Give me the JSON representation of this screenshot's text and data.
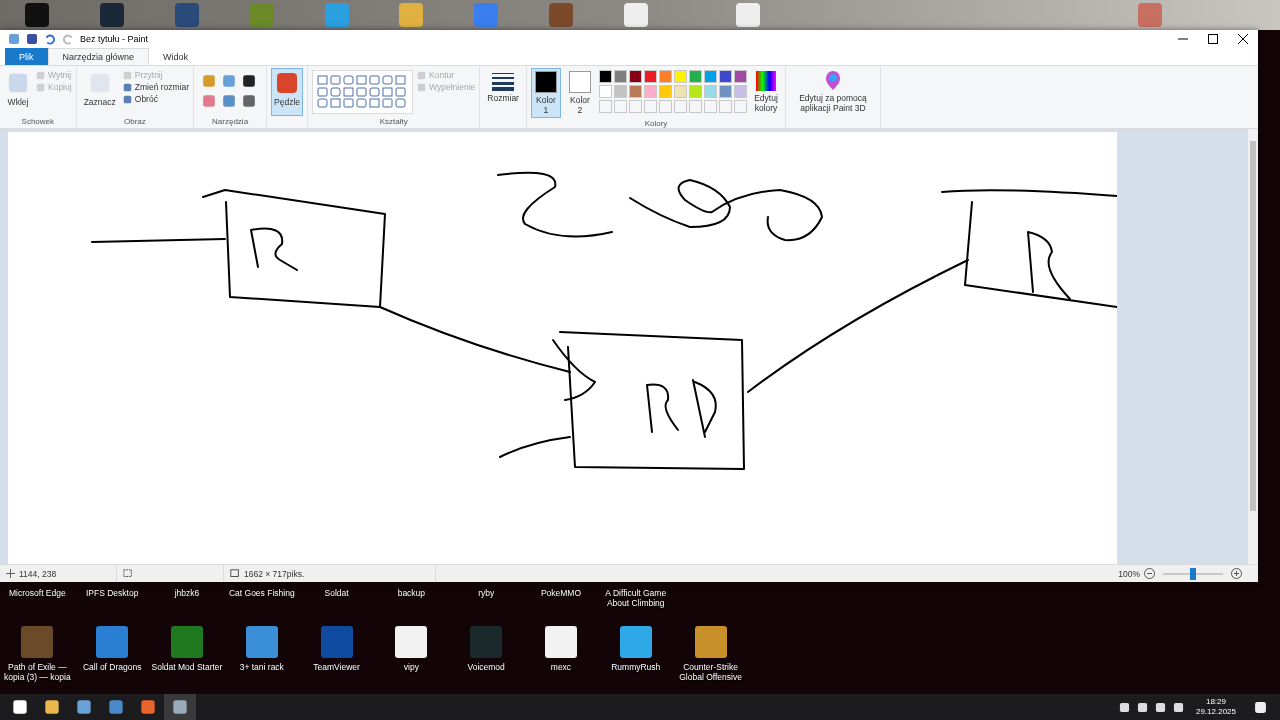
{
  "window": {
    "title": "Bez tytułu - Paint"
  },
  "tabs": [
    {
      "label": "Plik",
      "kind": "file",
      "selected": false
    },
    {
      "label": "Narzędzia główne",
      "kind": "tab",
      "selected": true
    },
    {
      "label": "Widok",
      "kind": "tab",
      "selected": false
    }
  ],
  "ribbon": {
    "groups": [
      {
        "kind": "buttons",
        "label": "Schowek",
        "large": {
          "label": "Wklej"
        },
        "small": [
          {
            "label": "Wytnij",
            "disabled": true
          },
          {
            "label": "Kopiuj",
            "disabled": true
          }
        ]
      },
      {
        "kind": "buttons",
        "label": "Obraz",
        "large": {
          "label": "Zaznacz"
        },
        "small": [
          {
            "label": "Przytnij",
            "disabled": true
          },
          {
            "label": "Zmień rozmiar",
            "disabled": false
          },
          {
            "label": "Obróć",
            "disabled": false
          }
        ]
      },
      {
        "kind": "tools",
        "label": "Narzędzia"
      },
      {
        "kind": "brushes",
        "large": {
          "label": "Pędzle",
          "selected": true
        }
      },
      {
        "kind": "shapes",
        "label": "Kształty",
        "small": [
          {
            "label": "Kontur",
            "disabled": true
          },
          {
            "label": "Wypełnienie",
            "disabled": true
          }
        ]
      },
      {
        "kind": "size",
        "large": {
          "label": "Rozmiar"
        }
      },
      {
        "kind": "colors",
        "label": "Kolory",
        "slots": [
          {
            "label": "Kolor 1",
            "color": "#000000",
            "selected": true
          },
          {
            "label": "Kolor 2",
            "color": "#ffffff",
            "selected": false
          }
        ],
        "palette": [
          {
            "color": "#000000"
          },
          {
            "color": "#7f7f7f"
          },
          {
            "color": "#880015"
          },
          {
            "color": "#ed1c24"
          },
          {
            "color": "#ff7f27"
          },
          {
            "color": "#fff200"
          },
          {
            "color": "#22b14c"
          },
          {
            "color": "#00a2e8"
          },
          {
            "color": "#3f48cc"
          },
          {
            "color": "#a349a4"
          },
          {
            "color": "#ffffff"
          },
          {
            "color": "#c3c3c3"
          },
          {
            "color": "#b97a57"
          },
          {
            "color": "#ffaec9"
          },
          {
            "color": "#ffc90e"
          },
          {
            "color": "#efe4b0"
          },
          {
            "color": "#b5e61d"
          },
          {
            "color": "#99d9ea"
          },
          {
            "color": "#7092be"
          },
          {
            "color": "#c8bfe7"
          }
        ],
        "edit": {
          "label": "Edytuj kolory"
        }
      },
      {
        "kind": "paint3d",
        "large": {
          "label": "Edytuj za pomocą aplikacji Paint 3D"
        }
      }
    ]
  },
  "status_bar": {
    "position": "1144, 238",
    "size": "1662 × 717piks.",
    "zoom": "100%",
    "zoom_slider": {
      "level": 0.5
    }
  },
  "desktop": {
    "row_1": [
      "Microsoft Edge",
      "IPFS Desktop",
      "jhbzk6",
      "Cat Goes Fishing",
      "Soldat",
      "backup",
      "ryby",
      "PokeMMO",
      "A Difficult Game About Climbing"
    ],
    "row_2": [
      {
        "label": "Path of Exile — kopia (3) — kopia",
        "color": "#6b4a2a"
      },
      {
        "label": "Call of Dragons",
        "color": "#2a7fd4"
      },
      {
        "label": "Soldat Mod Starter",
        "color": "#1f7a1f"
      },
      {
        "label": "3+ tani rack",
        "color": "#3a8fd8"
      },
      {
        "label": "TeamViewer",
        "color": "#0e4a9e"
      },
      {
        "label": "vipy",
        "color": "#f2f2f2"
      },
      {
        "label": "Voicemod",
        "color": "#1a2a2a"
      },
      {
        "label": "mexc",
        "color": "#f2f2f2"
      },
      {
        "label": "RummyRush",
        "color": "#2fa8e8"
      },
      {
        "label": "Counter-Strike Global Offensive",
        "color": "#c8902a"
      }
    ]
  },
  "taskbar": {
    "time": "18:29",
    "date": "29.12.2025"
  }
}
